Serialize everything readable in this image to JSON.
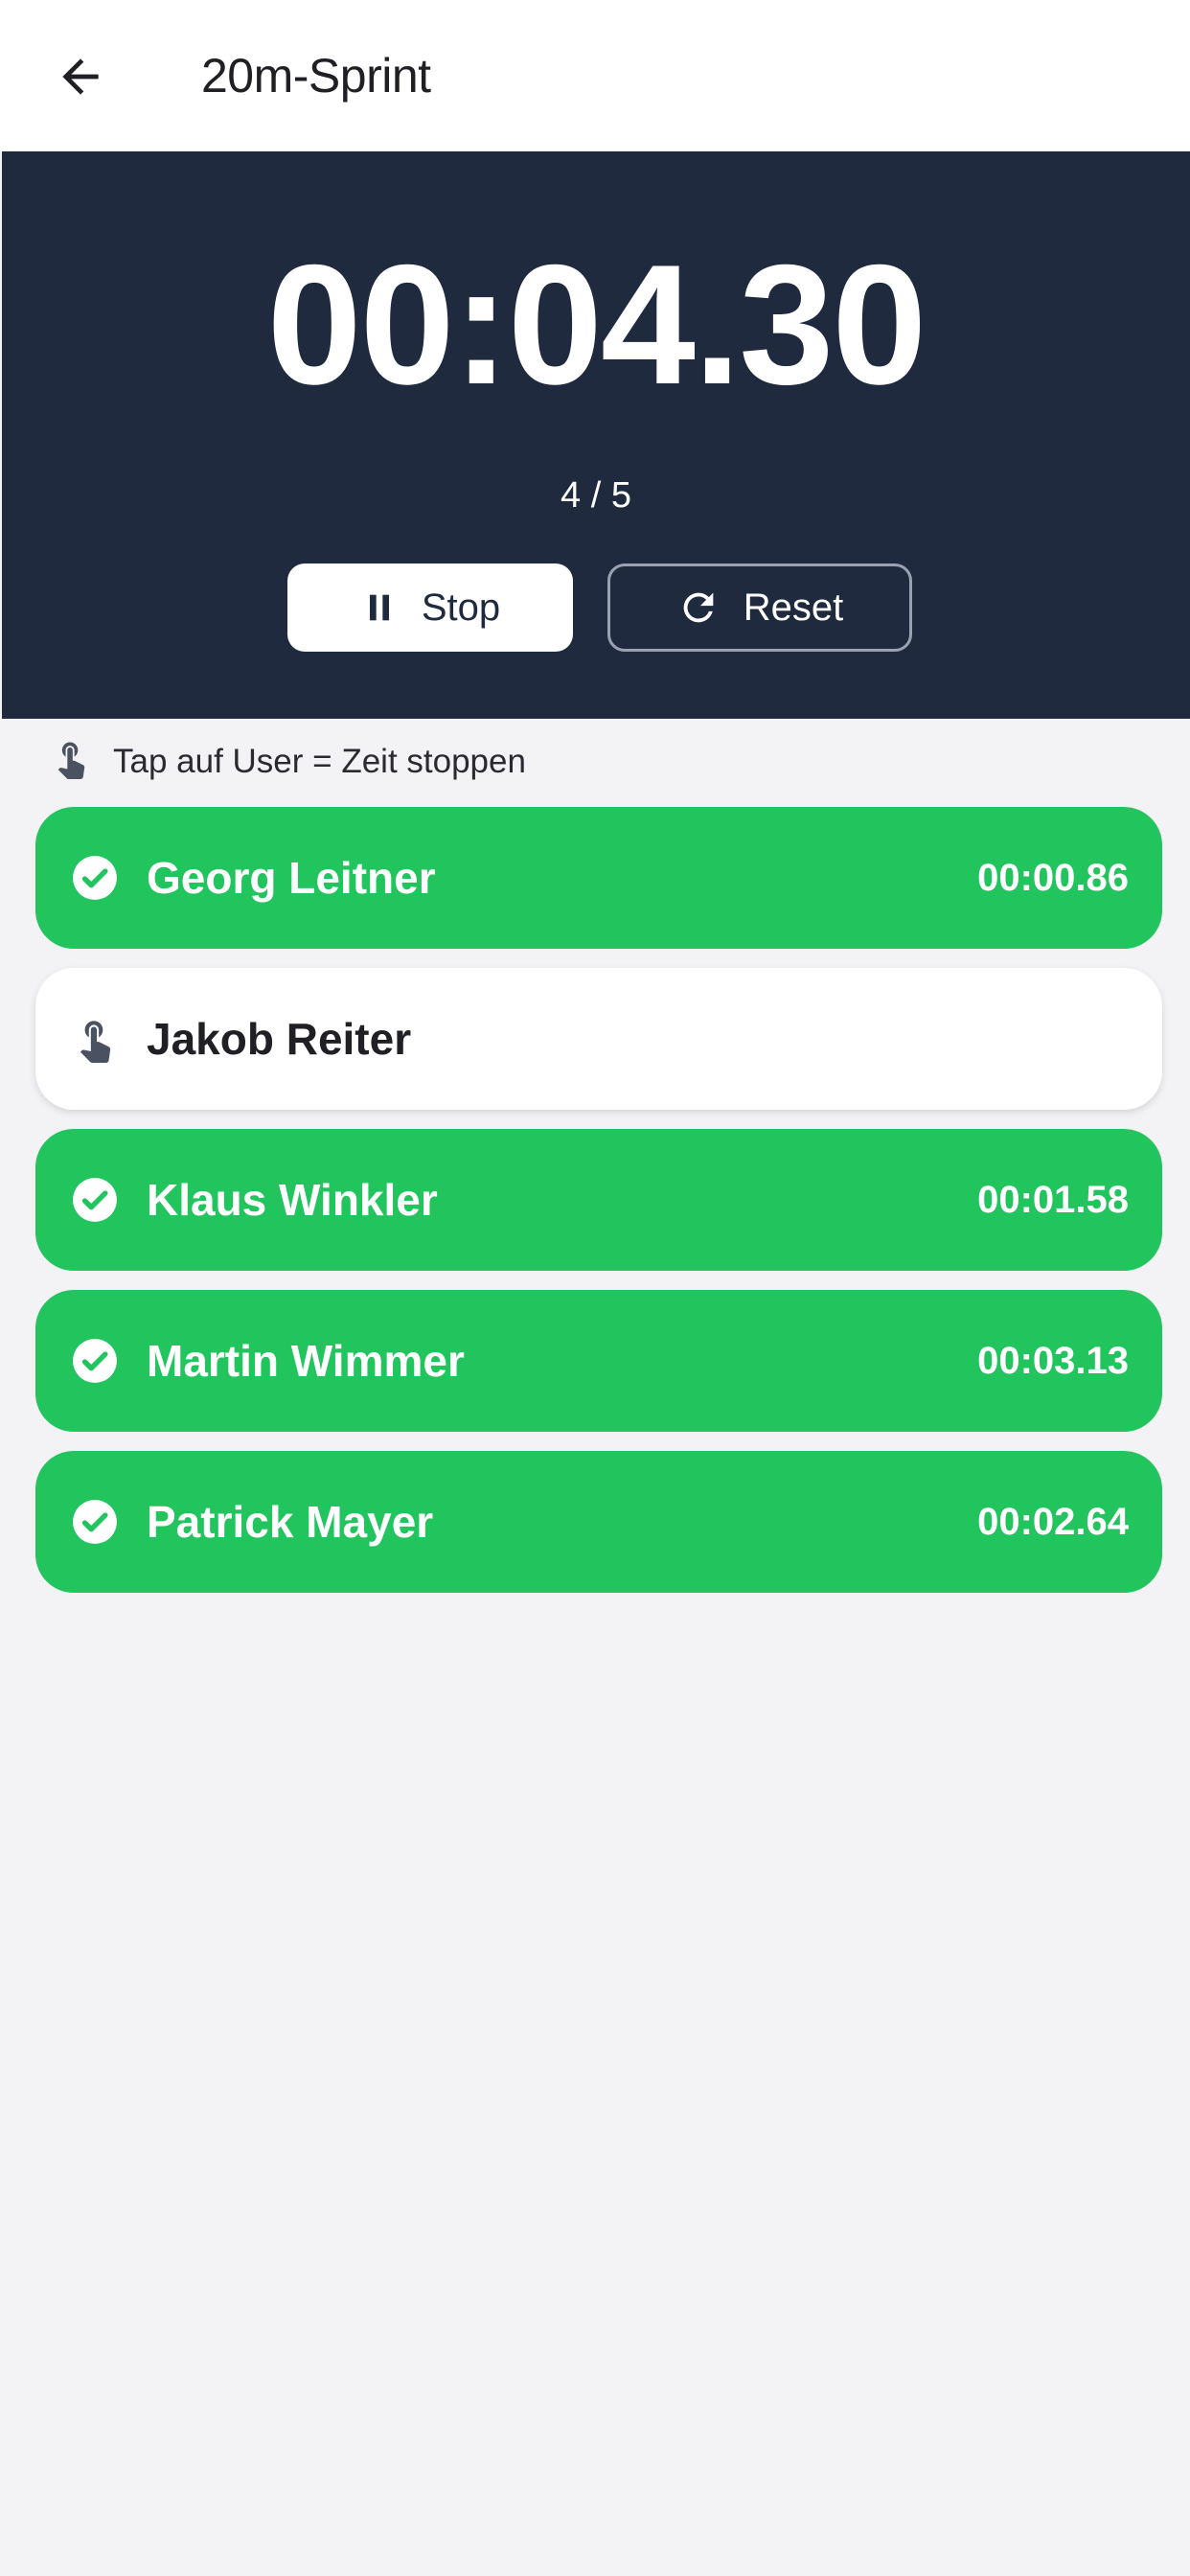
{
  "header": {
    "title": "20m-Sprint",
    "back_icon": "arrow-left-icon"
  },
  "timer": {
    "display": "00:04.30",
    "progress": "4 / 5",
    "stop_label": "Stop",
    "reset_label": "Reset",
    "panel_color": "#1f2a3f"
  },
  "hint": {
    "text": "Tap auf User = Zeit stoppen",
    "icon": "tap-finger-icon"
  },
  "participants": [
    {
      "name": "Georg Leitner",
      "time": "00:00.86",
      "status": "done"
    },
    {
      "name": "Jakob Reiter",
      "time": "",
      "status": "pending"
    },
    {
      "name": "Klaus Winkler",
      "time": "00:01.58",
      "status": "done"
    },
    {
      "name": "Martin Wimmer",
      "time": "00:03.13",
      "status": "done"
    },
    {
      "name": "Patrick Mayer",
      "time": "00:02.64",
      "status": "done"
    }
  ],
  "colors": {
    "done": "#22c45e",
    "background": "#f3f3f6"
  }
}
